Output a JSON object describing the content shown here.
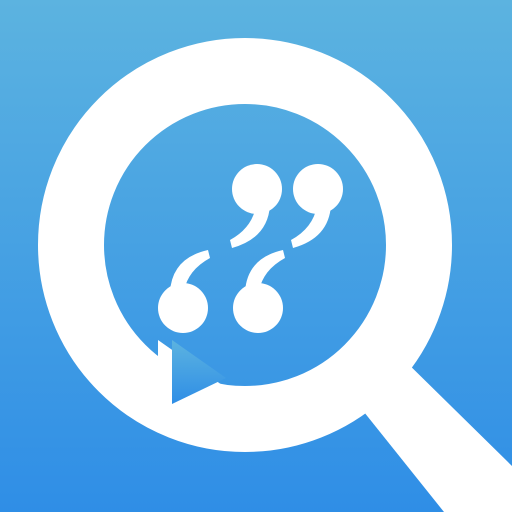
{
  "icon": {
    "name": "quote-search-app-icon",
    "elements": [
      "magnifier-icon",
      "speech-bubble-icon",
      "quotation-marks-icon"
    ],
    "colors": {
      "background_top": "#5cb3e0",
      "background_bottom": "#2f8ee6",
      "glyph": "#ffffff"
    }
  }
}
